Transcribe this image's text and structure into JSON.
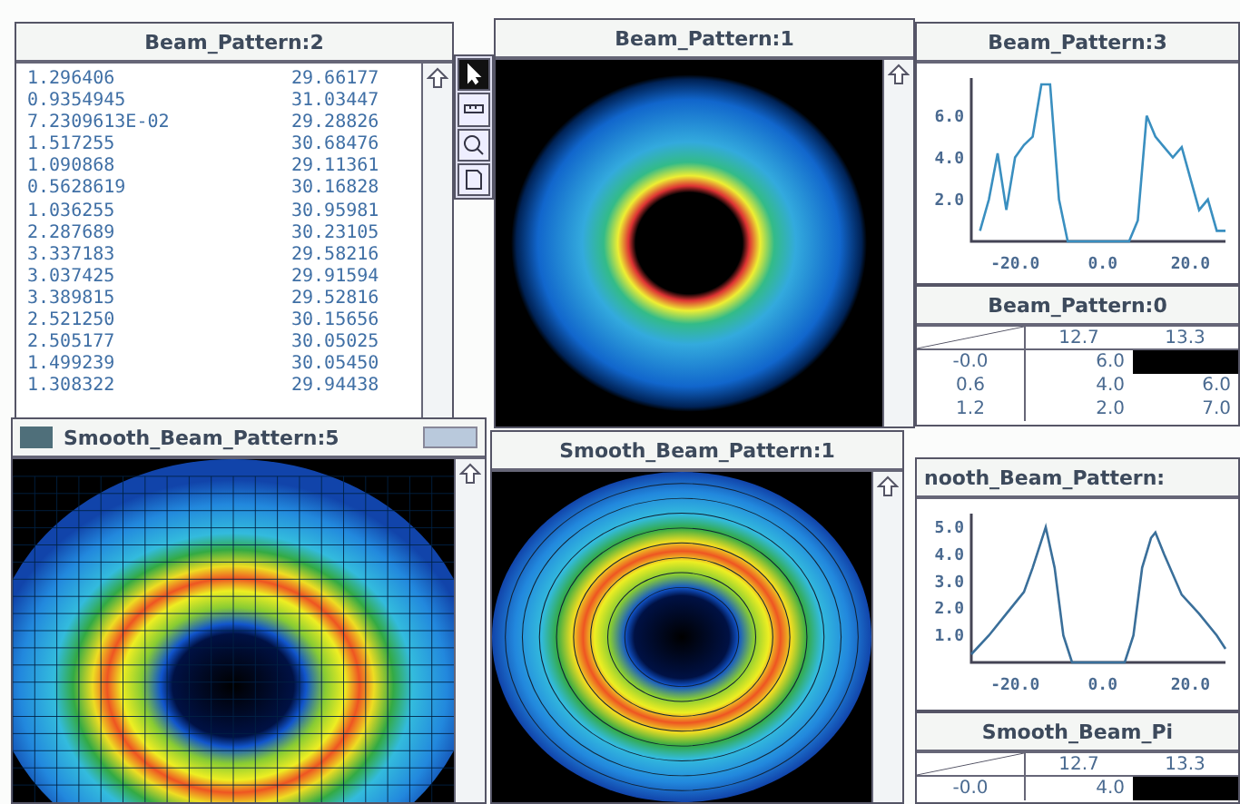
{
  "windows": [
    {
      "kind": "list",
      "title": "Beam_Pattern:2",
      "rows": [
        [
          "1.296406",
          "29.66177"
        ],
        [
          "0.9354945",
          "31.03447"
        ],
        [
          "7.2309613E-02",
          "29.28826"
        ],
        [
          "1.517255",
          "30.68476"
        ],
        [
          "1.090868",
          "29.11361"
        ],
        [
          "0.5628619",
          "30.16828"
        ],
        [
          "1.036255",
          "30.95981"
        ],
        [
          "2.287689",
          "30.23105"
        ],
        [
          "3.337183",
          "29.58216"
        ],
        [
          "3.037425",
          "29.91594"
        ],
        [
          "3.389815",
          "29.52816"
        ],
        [
          "2.521250",
          "30.15656"
        ],
        [
          "2.505177",
          "30.05025"
        ],
        [
          "1.499239",
          "30.05450"
        ],
        [
          "1.308322",
          "29.94438"
        ]
      ]
    },
    {
      "kind": "palette",
      "tools": [
        {
          "selected": true
        },
        {
          "selected": false
        },
        {
          "selected": false
        },
        {
          "selected": false
        }
      ]
    },
    {
      "kind": "ring",
      "title": "Beam_Pattern:1"
    },
    {
      "kind": "chart",
      "title": "Beam_Pattern:3",
      "chart_data": {
        "type": "line",
        "x": [
          -28,
          -26,
          -24,
          -22,
          -20,
          -18,
          -16,
          -14,
          -12,
          -10,
          -8,
          -6,
          -4,
          -2,
          0,
          2,
          4,
          6,
          8,
          10,
          12,
          14,
          16,
          18,
          20,
          22,
          24,
          26,
          28
        ],
        "series": [
          {
            "color": "#3a8fc0",
            "values": [
              0.5,
              2.0,
              4.2,
              1.5,
              4.0,
              4.6,
              5.0,
              7.5,
              7.5,
              2.0,
              0,
              0,
              0,
              0,
              0,
              0,
              0,
              0,
              1.0,
              6.0,
              5.0,
              4.5,
              4.0,
              4.5,
              3.0,
              1.5,
              2.0,
              0.5,
              0.5
            ]
          }
        ],
        "xlim": [
          -30,
          28
        ],
        "ylim": [
          0,
          7.8
        ],
        "xticks": [
          {
            "value": -20,
            "label": "-20.0"
          },
          {
            "value": 0,
            "label": "0.0"
          },
          {
            "value": 20,
            "label": "20.0"
          }
        ],
        "yticks": [
          {
            "value": 2,
            "label": "2.0"
          },
          {
            "value": 4,
            "label": "4.0"
          },
          {
            "value": 6,
            "label": "6.0"
          }
        ]
      }
    },
    {
      "kind": "grid",
      "title": "Beam_Pattern:0",
      "columns": [
        "12.7",
        "13.3"
      ],
      "rows": [
        {
          "label": "-0.0",
          "cells": [
            {
              "text": "6.0",
              "selected": false
            },
            {
              "selected": true
            }
          ]
        },
        {
          "label": "0.6",
          "cells": [
            {
              "text": "4.0",
              "selected": false
            },
            {
              "text": "6.0",
              "selected": false
            }
          ]
        },
        {
          "label": "1.2",
          "cells": [
            {
              "text": "2.0",
              "selected": false
            },
            {
              "text": "7.0",
              "selected": false
            }
          ]
        }
      ]
    },
    {
      "kind": "surface",
      "title": "Smooth_Beam_Pattern:5"
    },
    {
      "kind": "contour",
      "title": "Smooth_Beam_Pattern:1"
    },
    {
      "kind": "chart",
      "title": "nooth_Beam_Pattern:",
      "chart_data": {
        "type": "line",
        "x": [
          -30,
          -26,
          -22,
          -18,
          -16,
          -14,
          -13,
          -11,
          -9,
          -7,
          5,
          7,
          9,
          11,
          12,
          14,
          18,
          22,
          26,
          28
        ],
        "series": [
          {
            "color": "#3a6f9a",
            "values": [
              0.3,
              1.0,
              1.8,
              2.6,
              3.5,
              4.5,
              5.0,
              3.5,
              1.0,
              0,
              0,
              1.0,
              3.5,
              4.6,
              4.8,
              4.0,
              2.5,
              1.8,
              1.0,
              0.5
            ]
          }
        ],
        "xlim": [
          -30,
          28
        ],
        "ylim": [
          0,
          5.5
        ],
        "xticks": [
          {
            "value": -20,
            "label": "-20.0"
          },
          {
            "value": 0,
            "label": "0.0"
          },
          {
            "value": 20,
            "label": "20.0"
          }
        ],
        "yticks": [
          {
            "value": 1,
            "label": "1.0"
          },
          {
            "value": 2,
            "label": "2.0"
          },
          {
            "value": 3,
            "label": "3.0"
          },
          {
            "value": 4,
            "label": "4.0"
          },
          {
            "value": 5,
            "label": "5.0"
          }
        ]
      }
    },
    {
      "kind": "grid",
      "title": "Smooth_Beam_Pi",
      "columns": [
        "12.7",
        "13.3"
      ],
      "rows": [
        {
          "label": "-0.0",
          "cells": [
            {
              "text": "4.0",
              "selected": false
            },
            {
              "selected": true
            }
          ]
        }
      ]
    }
  ]
}
